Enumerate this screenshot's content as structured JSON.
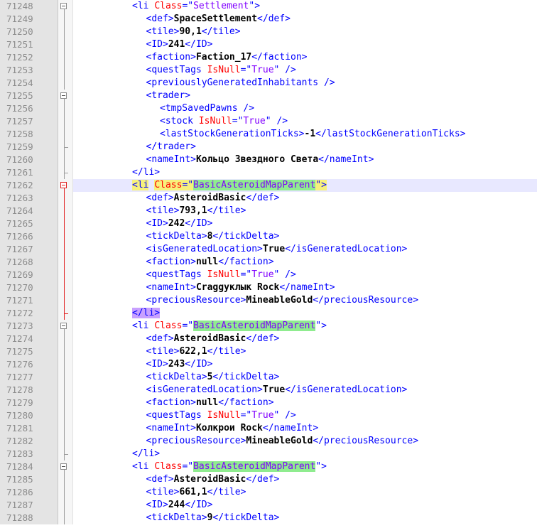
{
  "lines": [
    {
      "num": "71248",
      "indent": 4,
      "fold": "box",
      "tokens": [
        {
          "t": "tag",
          "v": "<li "
        },
        {
          "t": "attr",
          "v": "Class"
        },
        {
          "t": "tag",
          "v": "=\""
        },
        {
          "t": "val",
          "v": "Settlement"
        },
        {
          "t": "tag",
          "v": "\">"
        }
      ]
    },
    {
      "num": "71249",
      "indent": 5,
      "fold": "line",
      "tokens": [
        {
          "t": "tag",
          "v": "<def>"
        },
        {
          "t": "txt",
          "v": "SpaceSettlement"
        },
        {
          "t": "tag",
          "v": "</def>"
        }
      ]
    },
    {
      "num": "71250",
      "indent": 5,
      "fold": "line",
      "tokens": [
        {
          "t": "tag",
          "v": "<tile>"
        },
        {
          "t": "txt",
          "v": "90,1"
        },
        {
          "t": "tag",
          "v": "</tile>"
        }
      ]
    },
    {
      "num": "71251",
      "indent": 5,
      "fold": "line",
      "tokens": [
        {
          "t": "tag",
          "v": "<ID>"
        },
        {
          "t": "txt",
          "v": "241"
        },
        {
          "t": "tag",
          "v": "</ID>"
        }
      ]
    },
    {
      "num": "71252",
      "indent": 5,
      "fold": "line",
      "tokens": [
        {
          "t": "tag",
          "v": "<faction>"
        },
        {
          "t": "txt",
          "v": "Faction_17"
        },
        {
          "t": "tag",
          "v": "</faction>"
        }
      ]
    },
    {
      "num": "71253",
      "indent": 5,
      "fold": "line",
      "tokens": [
        {
          "t": "tag",
          "v": "<questTags "
        },
        {
          "t": "attr",
          "v": "IsNull"
        },
        {
          "t": "tag",
          "v": "=\""
        },
        {
          "t": "val",
          "v": "True"
        },
        {
          "t": "tag",
          "v": "\" />"
        }
      ]
    },
    {
      "num": "71254",
      "indent": 5,
      "fold": "line",
      "tokens": [
        {
          "t": "tag",
          "v": "<previouslyGeneratedInhabitants />"
        }
      ]
    },
    {
      "num": "71255",
      "indent": 5,
      "fold": "box",
      "tokens": [
        {
          "t": "tag",
          "v": "<trader>"
        }
      ]
    },
    {
      "num": "71256",
      "indent": 6,
      "fold": "line",
      "tokens": [
        {
          "t": "tag",
          "v": "<tmpSavedPawns />"
        }
      ]
    },
    {
      "num": "71257",
      "indent": 6,
      "fold": "line",
      "tokens": [
        {
          "t": "tag",
          "v": "<stock "
        },
        {
          "t": "attr",
          "v": "IsNull"
        },
        {
          "t": "tag",
          "v": "=\""
        },
        {
          "t": "val",
          "v": "True"
        },
        {
          "t": "tag",
          "v": "\" />"
        }
      ]
    },
    {
      "num": "71258",
      "indent": 6,
      "fold": "line",
      "tokens": [
        {
          "t": "tag",
          "v": "<lastStockGenerationTicks>"
        },
        {
          "t": "txt",
          "v": "-1"
        },
        {
          "t": "tag",
          "v": "</lastStockGenerationTicks>"
        }
      ]
    },
    {
      "num": "71259",
      "indent": 5,
      "fold": "end",
      "tokens": [
        {
          "t": "tag",
          "v": "</trader>"
        }
      ]
    },
    {
      "num": "71260",
      "indent": 5,
      "fold": "line",
      "tokens": [
        {
          "t": "tag",
          "v": "<nameInt>"
        },
        {
          "t": "txt",
          "v": "Кольцо Звездного Света"
        },
        {
          "t": "tag",
          "v": "</nameInt>"
        }
      ]
    },
    {
      "num": "71261",
      "indent": 4,
      "fold": "end",
      "tokens": [
        {
          "t": "tag",
          "v": "</li>"
        }
      ]
    },
    {
      "num": "71262",
      "indent": 4,
      "fold": "box-red",
      "active": true,
      "tokens": [
        {
          "t": "tag",
          "v": "<li",
          "h": "yellow"
        },
        {
          "t": "tag",
          "v": " "
        },
        {
          "t": "attr",
          "v": "Class",
          "h": "yellow"
        },
        {
          "t": "tag",
          "v": "=\"",
          "h": "yellow"
        },
        {
          "t": "val",
          "v": "BasicAsteroidMapParent",
          "h": "green"
        },
        {
          "t": "tag",
          "v": "\">",
          "h": "yellow"
        }
      ]
    },
    {
      "num": "71263",
      "indent": 5,
      "fold": "line-red",
      "tokens": [
        {
          "t": "tag",
          "v": "<def>"
        },
        {
          "t": "txt",
          "v": "AsteroidBasic"
        },
        {
          "t": "tag",
          "v": "</def>"
        }
      ]
    },
    {
      "num": "71264",
      "indent": 5,
      "fold": "line-red",
      "tokens": [
        {
          "t": "tag",
          "v": "<tile>"
        },
        {
          "t": "txt",
          "v": "793,1"
        },
        {
          "t": "tag",
          "v": "</tile>"
        }
      ]
    },
    {
      "num": "71265",
      "indent": 5,
      "fold": "line-red",
      "tokens": [
        {
          "t": "tag",
          "v": "<ID>"
        },
        {
          "t": "txt",
          "v": "242"
        },
        {
          "t": "tag",
          "v": "</ID>"
        }
      ]
    },
    {
      "num": "71266",
      "indent": 5,
      "fold": "line-red",
      "tokens": [
        {
          "t": "tag",
          "v": "<tickDelta>"
        },
        {
          "t": "txt",
          "v": "8"
        },
        {
          "t": "tag",
          "v": "</tickDelta>"
        }
      ]
    },
    {
      "num": "71267",
      "indent": 5,
      "fold": "line-red",
      "tokens": [
        {
          "t": "tag",
          "v": "<isGeneratedLocation>"
        },
        {
          "t": "txt",
          "v": "True"
        },
        {
          "t": "tag",
          "v": "</isGeneratedLocation>"
        }
      ]
    },
    {
      "num": "71268",
      "indent": 5,
      "fold": "line-red",
      "tokens": [
        {
          "t": "tag",
          "v": "<faction>"
        },
        {
          "t": "txt",
          "v": "null"
        },
        {
          "t": "tag",
          "v": "</faction>"
        }
      ]
    },
    {
      "num": "71269",
      "indent": 5,
      "fold": "line-red",
      "tokens": [
        {
          "t": "tag",
          "v": "<questTags "
        },
        {
          "t": "attr",
          "v": "IsNull"
        },
        {
          "t": "tag",
          "v": "=\""
        },
        {
          "t": "val",
          "v": "True"
        },
        {
          "t": "tag",
          "v": "\" />"
        }
      ]
    },
    {
      "num": "71270",
      "indent": 5,
      "fold": "line-red",
      "tokens": [
        {
          "t": "tag",
          "v": "<nameInt>"
        },
        {
          "t": "txt",
          "v": "Craggуклык Rock"
        },
        {
          "t": "tag",
          "v": "</nameInt>"
        }
      ]
    },
    {
      "num": "71271",
      "indent": 5,
      "fold": "line-red",
      "tokens": [
        {
          "t": "tag",
          "v": "<preciousResource>"
        },
        {
          "t": "txt",
          "v": "MineableGold"
        },
        {
          "t": "tag",
          "v": "</preciousResource>"
        }
      ]
    },
    {
      "num": "71272",
      "indent": 4,
      "fold": "end-red",
      "tokens": [
        {
          "t": "tag",
          "v": "</li>",
          "h": "purple"
        }
      ]
    },
    {
      "num": "71273",
      "indent": 4,
      "fold": "box",
      "tokens": [
        {
          "t": "tag",
          "v": "<li "
        },
        {
          "t": "attr",
          "v": "Class"
        },
        {
          "t": "tag",
          "v": "=\""
        },
        {
          "t": "val",
          "v": "BasicAsteroidMapParent",
          "h": "green"
        },
        {
          "t": "tag",
          "v": "\">"
        }
      ]
    },
    {
      "num": "71274",
      "indent": 5,
      "fold": "line",
      "tokens": [
        {
          "t": "tag",
          "v": "<def>"
        },
        {
          "t": "txt",
          "v": "AsteroidBasic"
        },
        {
          "t": "tag",
          "v": "</def>"
        }
      ]
    },
    {
      "num": "71275",
      "indent": 5,
      "fold": "line",
      "tokens": [
        {
          "t": "tag",
          "v": "<tile>"
        },
        {
          "t": "txt",
          "v": "622,1"
        },
        {
          "t": "tag",
          "v": "</tile>"
        }
      ]
    },
    {
      "num": "71276",
      "indent": 5,
      "fold": "line",
      "tokens": [
        {
          "t": "tag",
          "v": "<ID>"
        },
        {
          "t": "txt",
          "v": "243"
        },
        {
          "t": "tag",
          "v": "</ID>"
        }
      ]
    },
    {
      "num": "71277",
      "indent": 5,
      "fold": "line",
      "tokens": [
        {
          "t": "tag",
          "v": "<tickDelta>"
        },
        {
          "t": "txt",
          "v": "5"
        },
        {
          "t": "tag",
          "v": "</tickDelta>"
        }
      ]
    },
    {
      "num": "71278",
      "indent": 5,
      "fold": "line",
      "tokens": [
        {
          "t": "tag",
          "v": "<isGeneratedLocation>"
        },
        {
          "t": "txt",
          "v": "True"
        },
        {
          "t": "tag",
          "v": "</isGeneratedLocation>"
        }
      ]
    },
    {
      "num": "71279",
      "indent": 5,
      "fold": "line",
      "tokens": [
        {
          "t": "tag",
          "v": "<faction>"
        },
        {
          "t": "txt",
          "v": "null"
        },
        {
          "t": "tag",
          "v": "</faction>"
        }
      ]
    },
    {
      "num": "71280",
      "indent": 5,
      "fold": "line",
      "tokens": [
        {
          "t": "tag",
          "v": "<questTags "
        },
        {
          "t": "attr",
          "v": "IsNull"
        },
        {
          "t": "tag",
          "v": "=\""
        },
        {
          "t": "val",
          "v": "True"
        },
        {
          "t": "tag",
          "v": "\" />"
        }
      ]
    },
    {
      "num": "71281",
      "indent": 5,
      "fold": "line",
      "tokens": [
        {
          "t": "tag",
          "v": "<nameInt>"
        },
        {
          "t": "txt",
          "v": "Колкрои Rock"
        },
        {
          "t": "tag",
          "v": "</nameInt>"
        }
      ]
    },
    {
      "num": "71282",
      "indent": 5,
      "fold": "line",
      "tokens": [
        {
          "t": "tag",
          "v": "<preciousResource>"
        },
        {
          "t": "txt",
          "v": "MineableGold"
        },
        {
          "t": "tag",
          "v": "</preciousResource>"
        }
      ]
    },
    {
      "num": "71283",
      "indent": 4,
      "fold": "end",
      "tokens": [
        {
          "t": "tag",
          "v": "</li>"
        }
      ]
    },
    {
      "num": "71284",
      "indent": 4,
      "fold": "box",
      "tokens": [
        {
          "t": "tag",
          "v": "<li "
        },
        {
          "t": "attr",
          "v": "Class"
        },
        {
          "t": "tag",
          "v": "=\""
        },
        {
          "t": "val",
          "v": "BasicAsteroidMapParent",
          "h": "green"
        },
        {
          "t": "tag",
          "v": "\">"
        }
      ]
    },
    {
      "num": "71285",
      "indent": 5,
      "fold": "line",
      "tokens": [
        {
          "t": "tag",
          "v": "<def>"
        },
        {
          "t": "txt",
          "v": "AsteroidBasic"
        },
        {
          "t": "tag",
          "v": "</def>"
        }
      ]
    },
    {
      "num": "71286",
      "indent": 5,
      "fold": "line",
      "tokens": [
        {
          "t": "tag",
          "v": "<tile>"
        },
        {
          "t": "txt",
          "v": "661,1"
        },
        {
          "t": "tag",
          "v": "</tile>"
        }
      ]
    },
    {
      "num": "71287",
      "indent": 5,
      "fold": "line",
      "tokens": [
        {
          "t": "tag",
          "v": "<ID>"
        },
        {
          "t": "txt",
          "v": "244"
        },
        {
          "t": "tag",
          "v": "</ID>"
        }
      ]
    },
    {
      "num": "71288",
      "indent": 5,
      "fold": "line",
      "tokens": [
        {
          "t": "tag",
          "v": "<tickDelta>"
        },
        {
          "t": "txt",
          "v": "9"
        },
        {
          "t": "tag",
          "v": "</tickDelta>"
        }
      ]
    }
  ]
}
